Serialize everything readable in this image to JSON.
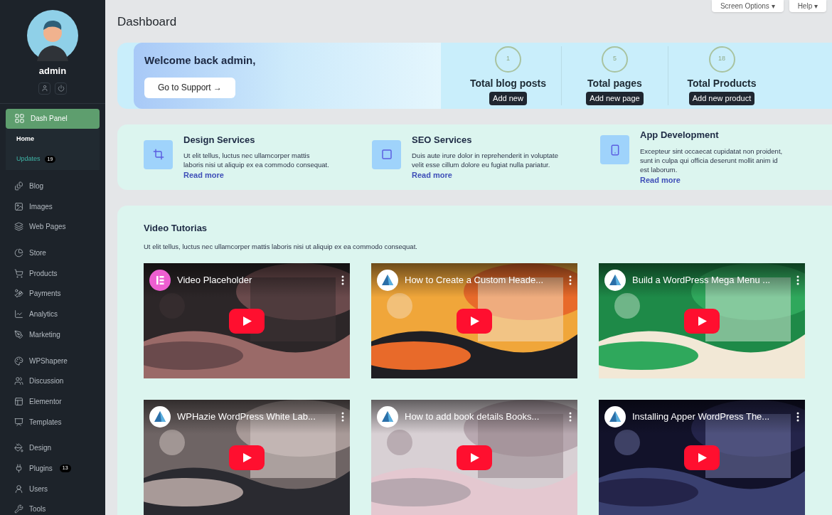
{
  "top_buttons": [
    {
      "label": "Screen Options ▾"
    },
    {
      "label": "Help ▾"
    }
  ],
  "sidebar": {
    "user": "admin",
    "groups": [
      {
        "items": [
          {
            "label": "Dash Panel",
            "selected": true,
            "children": [
              {
                "label": "Home",
                "selected": true
              },
              {
                "label": "Updates",
                "selected": false,
                "badge": "19"
              }
            ]
          }
        ]
      },
      {
        "items": [
          {
            "label": "Blog",
            "selected": false
          },
          {
            "label": "Images",
            "selected": false
          },
          {
            "label": "Web Pages",
            "selected": false
          }
        ]
      },
      {
        "items": [
          {
            "label": "Store",
            "selected": false
          },
          {
            "label": "Products",
            "selected": false
          },
          {
            "label": "Payments",
            "selected": false
          },
          {
            "label": "Analytics",
            "selected": false
          },
          {
            "label": "Marketing",
            "selected": false
          }
        ]
      },
      {
        "items": [
          {
            "label": "WPShapere",
            "selected": false
          },
          {
            "label": "Discussion",
            "selected": false
          },
          {
            "label": "Elementor",
            "selected": false
          },
          {
            "label": "Templates",
            "selected": false
          }
        ]
      },
      {
        "items": [
          {
            "label": "Design",
            "selected": false
          },
          {
            "label": "Plugins",
            "selected": false,
            "badge": "13"
          },
          {
            "label": "Users",
            "selected": false
          },
          {
            "label": "Tools",
            "selected": false
          }
        ]
      }
    ]
  },
  "page_title": "Dashboard",
  "welcome": {
    "title": "Welcome back admin,",
    "button": "Go to Support →"
  },
  "stats": [
    {
      "count": "1",
      "label": "Total blog posts",
      "button": "Add new"
    },
    {
      "count": "5",
      "label": "Total pages",
      "button": "Add new page"
    },
    {
      "count": "18",
      "label": "Total Products",
      "button": "Add new product"
    }
  ],
  "services": [
    {
      "title": "Design Services",
      "text": "Ut elit tellus, luctus nec ullamcorper mattis  laboris nisi ut aliquip ex ea commodo consequat.",
      "link": "Read more"
    },
    {
      "title": "SEO Services",
      "text": "Duis aute irure dolor in reprehenderit in voluptate velit esse cillum dolore eu fugiat nulla pariatur.",
      "link": "Read more"
    },
    {
      "title": "App Development",
      "text": "Excepteur sint occaecat cupidatat non proident, sunt in culpa qui officia deserunt mollit anim id est laborum.",
      "link": "Read more"
    }
  ],
  "videos": {
    "title": "Video Tutorias",
    "text": "Ut elit tellus, luctus nec ullamcorper mattis  laboris nisi ut aliquip ex ea commodo consequat.",
    "items": [
      {
        "title": "Video Placeholder",
        "kind": "picture"
      },
      {
        "title": "How to Create a Custom Heade...",
        "kind": "picture"
      },
      {
        "title": "Build a WordPress Mega Menu ...",
        "kind": "picture"
      },
      {
        "title": "WPHazie WordPress White Lab...",
        "kind": "picture"
      },
      {
        "title": "How to add book details Books...",
        "kind": "picture"
      },
      {
        "title": "Installing Apper WordPress The...",
        "kind": "picture"
      }
    ]
  }
}
